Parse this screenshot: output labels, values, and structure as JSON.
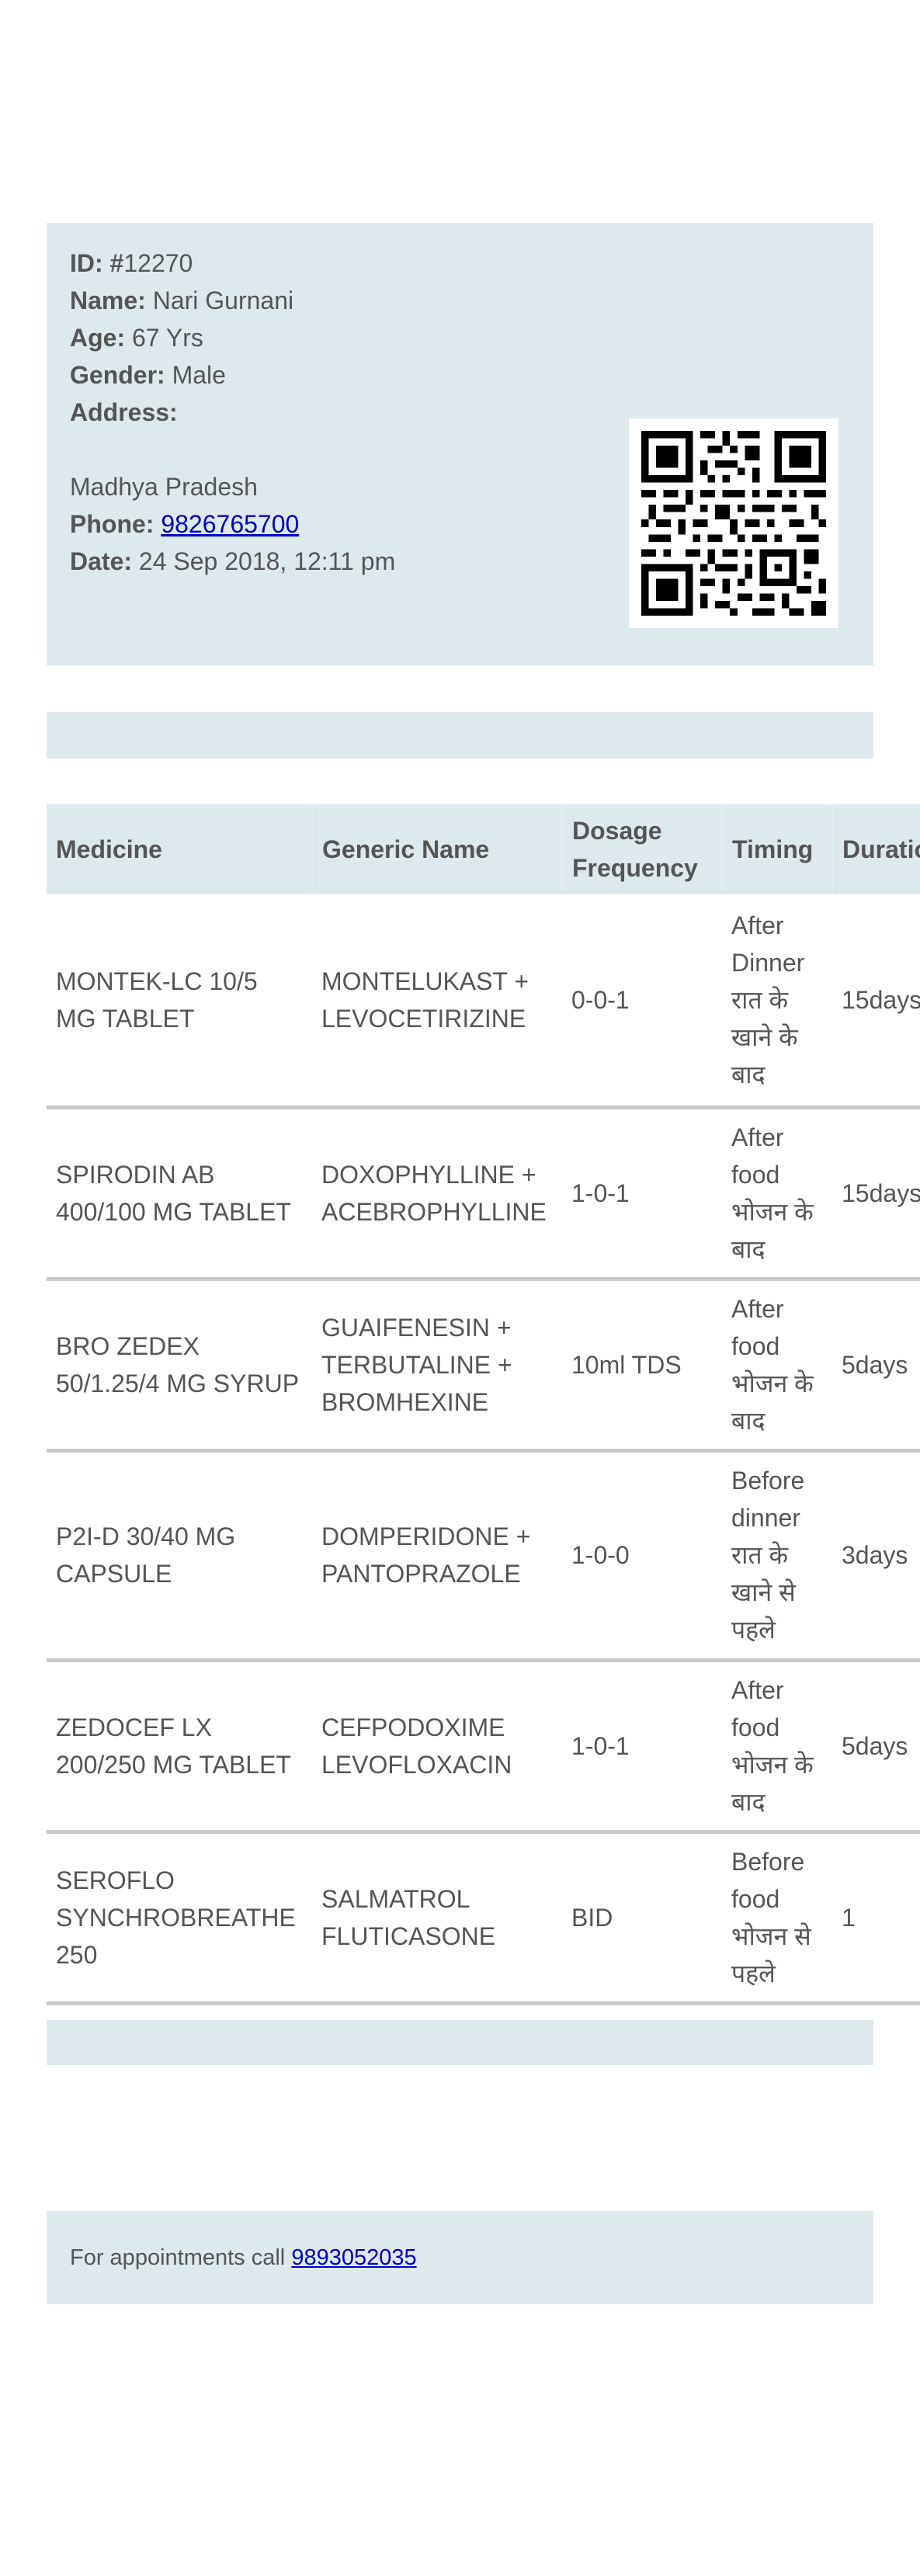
{
  "patient": {
    "id_label": "ID: #",
    "id_value": "12270",
    "name_label": "Name:",
    "name_value": "Nari Gurnani",
    "age_label": "Age:",
    "age_value": "67 Yrs",
    "gender_label": "Gender:",
    "gender_value": "Male",
    "address_label": "Address:",
    "address_value": "Madhya Pradesh",
    "phone_label": "Phone:",
    "phone_value": "9826765700",
    "date_label": "Date:",
    "date_value": "24 Sep 2018, 12:11 pm"
  },
  "qr_code": {
    "icon": "qr-code-icon"
  },
  "table": {
    "headers": {
      "medicine": "Medicine",
      "generic": "Generic Name",
      "dosage_line1": "Dosage",
      "dosage_line2": "Frequency",
      "timing": "Timing",
      "duration": "Duration"
    },
    "rows": [
      {
        "medicine": "MONTEK-LC 10/5 MG TABLET",
        "generic": "MONTELUKAST + LEVOCETIRIZINE",
        "dosage": "0-0-1",
        "timing_en_1": "After",
        "timing_en_2": "Dinner",
        "timing_hi": "रात के खाने के बाद",
        "duration": "15days"
      },
      {
        "medicine": "SPIRODIN AB 400/100 MG TABLET",
        "generic": "DOXOPHYLLINE + ACEBROPHYLLINE",
        "dosage": "1-0-1",
        "timing_en_1": "After",
        "timing_en_2": "food",
        "timing_hi": "भोजन के बाद",
        "duration": "15days"
      },
      {
        "medicine": "BRO ZEDEX 50/1.25/4 MG SYRUP",
        "generic": "GUAIFENESIN + TERBUTALINE + BROMHEXINE",
        "dosage": "10ml TDS",
        "timing_en_1": "After",
        "timing_en_2": "food",
        "timing_hi": "भोजन के बाद",
        "duration": "5days"
      },
      {
        "medicine": "P2I-D 30/40 MG CAPSULE",
        "generic": "DOMPERIDONE + PANTOPRAZOLE",
        "dosage": "1-0-0",
        "timing_en_1": "Before",
        "timing_en_2": "dinner",
        "timing_hi": "रात के खाने से पहले",
        "duration": "3days"
      },
      {
        "medicine": "ZEDOCEF LX 200/250 MG TABLET",
        "generic": "CEFPODOXIME LEVOFLOXACIN",
        "dosage": "1-0-1",
        "timing_en_1": "After",
        "timing_en_2": "food",
        "timing_hi": "भोजन के बाद",
        "duration": "5days"
      },
      {
        "medicine": "SEROFLO SYNCHROBREATHE 250",
        "generic": "SALMATROL FLUTICASONE",
        "dosage": "BID",
        "timing_en_1": "Before",
        "timing_en_2": "food",
        "timing_hi": "भोजन से पहले",
        "duration": "1"
      }
    ]
  },
  "footer": {
    "text": "For appointments call",
    "phone": "9893052035"
  },
  "colors": {
    "panel_bg": "#dde9ec",
    "text": "#555555",
    "link": "#0000cc",
    "row_divider": "#c8c8c8"
  }
}
